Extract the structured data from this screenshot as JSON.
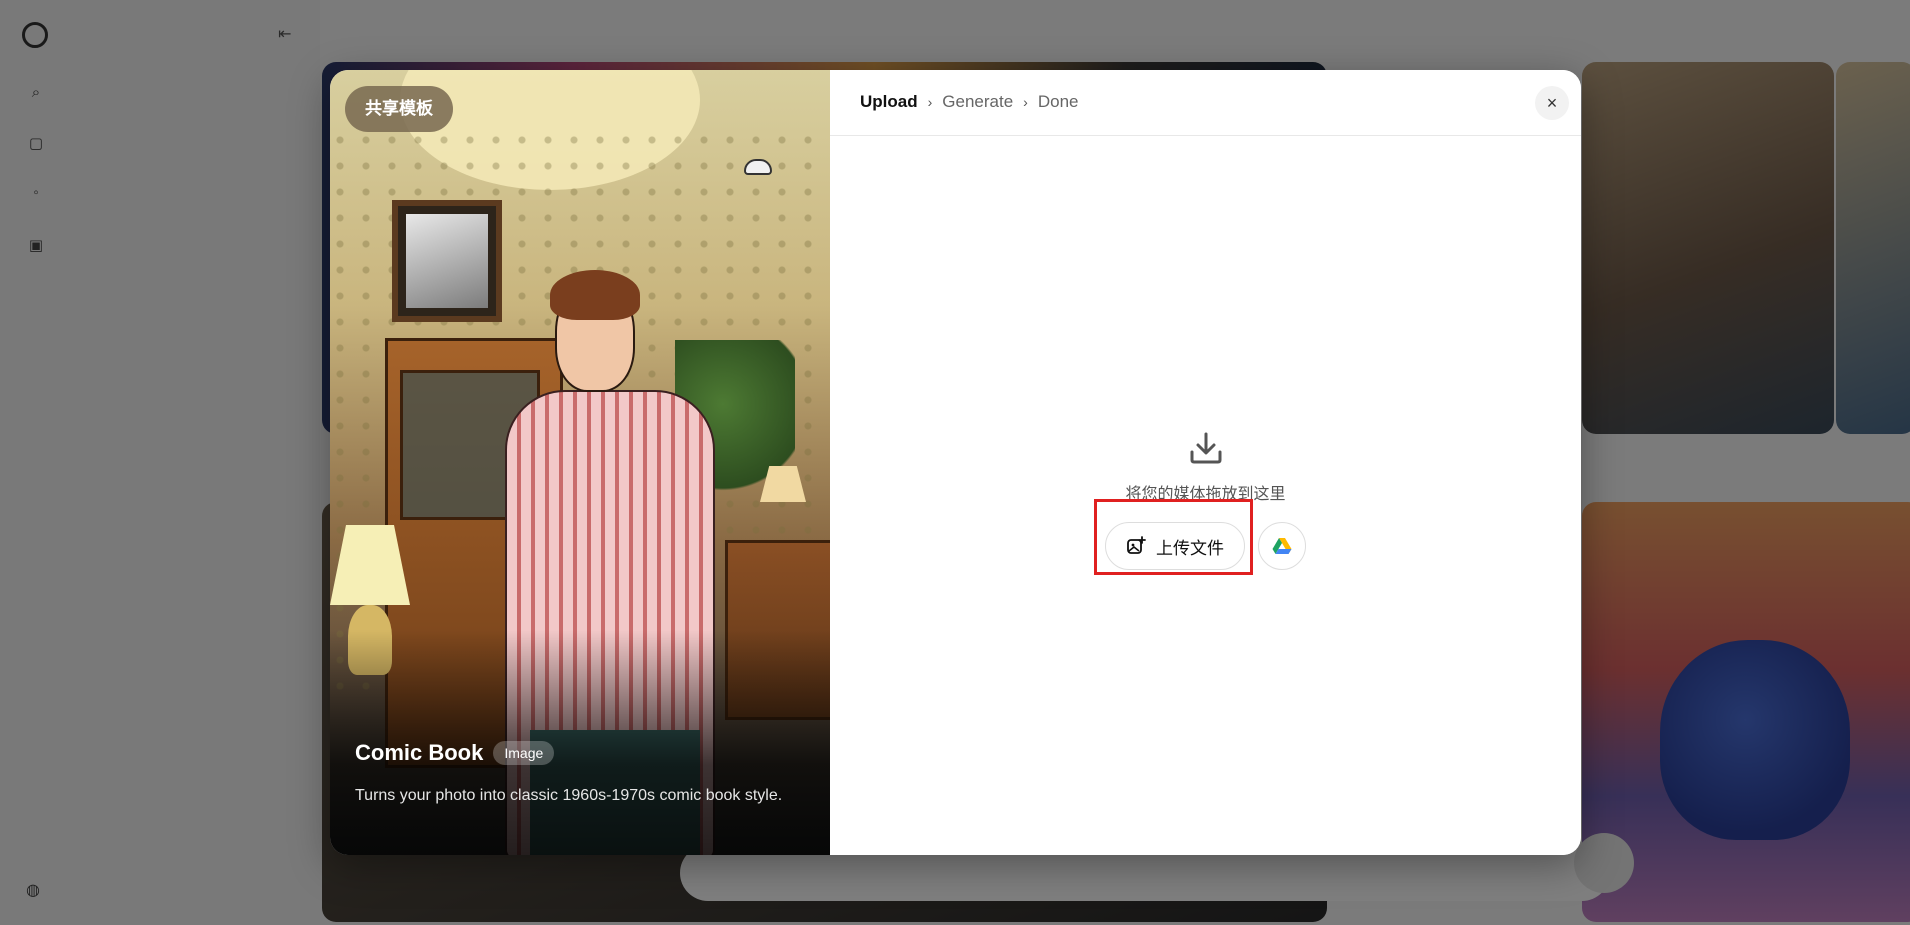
{
  "modal": {
    "template_badge": "共享模板",
    "template_title": "Comic Book",
    "template_type": "Image",
    "template_description": "Turns your photo into classic 1960s-1970s comic book style.",
    "steps": [
      "Upload",
      "Generate",
      "Done"
    ],
    "step_separator": "›",
    "close_label": "×",
    "drop_text": "将您的媒体拖放到这里",
    "upload_label": "上传文件"
  },
  "icons": {
    "drop": "download-tray-icon",
    "upload": "image-add-icon",
    "drive": "google-drive-icon",
    "close": "close-icon"
  },
  "colors": {
    "highlight": "#e02020",
    "badge_bg": "#786850",
    "drive_green": "#1ea362",
    "drive_yellow": "#ffba00",
    "drive_blue": "#4285f4"
  }
}
